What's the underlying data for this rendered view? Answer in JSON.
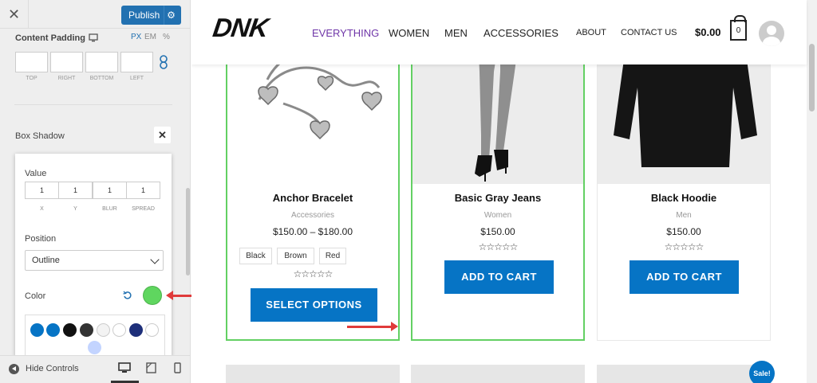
{
  "sidebar": {
    "close_label": "✕",
    "publish_label": "Publish",
    "content_padding": {
      "title": "Content Padding",
      "units": [
        "PX",
        "EM",
        "%"
      ],
      "fields": [
        "TOP",
        "RIGHT",
        "BOTTOM",
        "LEFT"
      ]
    },
    "box_shadow": {
      "title": "Box Shadow",
      "close_label": "✕",
      "value_label": "Value",
      "values": [
        {
          "value": "1",
          "caption": "X"
        },
        {
          "value": "1",
          "caption": "Y"
        },
        {
          "value": "1",
          "caption": "BLUR"
        },
        {
          "value": "1",
          "caption": "SPREAD"
        }
      ],
      "position_label": "Position",
      "position_value": "Outline",
      "color_label": "Color",
      "selected_color": "#5fd65f",
      "palette": [
        "#0674c5",
        "#0674c5",
        "#111111",
        "#333333",
        "#f3f3f3",
        "#ffffff",
        "#1e2f7a",
        "#ffffff",
        "#c3d4ff"
      ]
    },
    "hide_controls_label": "Hide Controls"
  },
  "site": {
    "logo": "DNK",
    "nav": [
      "EVERYTHING",
      "WOMEN",
      "MEN",
      "ACCESSORIES"
    ],
    "nav_secondary": [
      "ABOUT",
      "CONTACT US"
    ],
    "cart_total": "$0.00",
    "cart_count": "0",
    "products": [
      {
        "title": "Anchor Bracelet",
        "category": "Accessories",
        "price": "$150.00 – $180.00",
        "attributes": [
          "Black",
          "Brown",
          "Red"
        ],
        "rating_stars": "☆☆☆☆☆",
        "button": "SELECT OPTIONS"
      },
      {
        "title": "Basic Gray Jeans",
        "category": "Women",
        "price": "$150.00",
        "rating_stars": "☆☆☆☆☆",
        "button": "ADD TO CART"
      },
      {
        "title": "Black Hoodie",
        "category": "Men",
        "price": "$150.00",
        "rating_stars": "☆☆☆☆☆",
        "button": "ADD TO CART"
      }
    ],
    "sale_badge": "Sale!"
  },
  "colors": {
    "accent": "#0674c5",
    "nav_active": "#6f36a8",
    "highlight_border": "#63d063",
    "annotation_arrow": "#e03b3b"
  }
}
